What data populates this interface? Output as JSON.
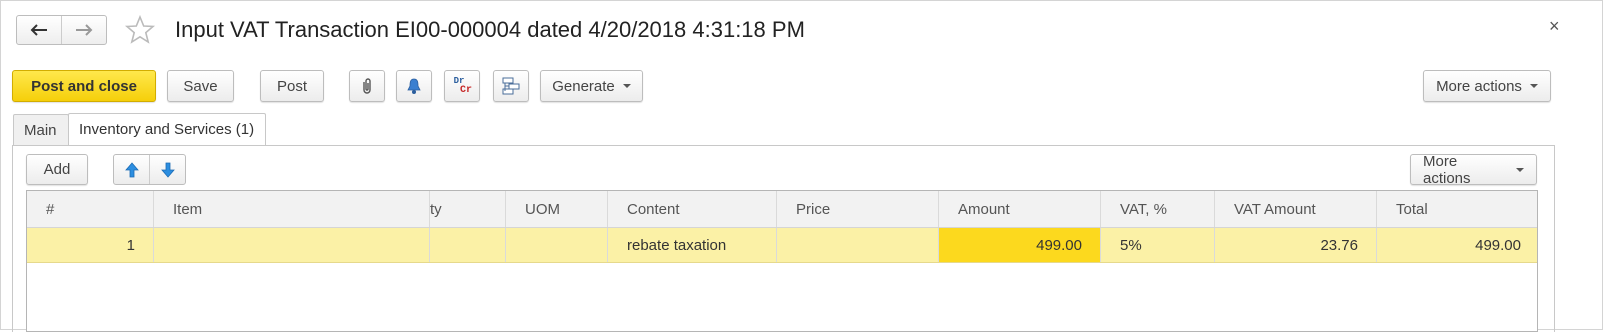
{
  "window": {
    "title": "Input VAT Transaction EI00-000004 dated 4/20/2018 4:31:18 PM",
    "close_label": "×"
  },
  "toolbar": {
    "post_close_label": "Post and close",
    "save_label": "Save",
    "post_label": "Post",
    "generate_label": "Generate",
    "more_actions_label": "More actions",
    "dr_label": "Dr",
    "cr_label": "Cr"
  },
  "tabs": [
    {
      "label": "Main",
      "active": false
    },
    {
      "label": "Inventory and Services (1)",
      "active": true
    }
  ],
  "subtoolbar": {
    "add_label": "Add",
    "more_actions_label": "More actions"
  },
  "table": {
    "columns": [
      "#",
      "Item",
      "ty",
      "UOM",
      "Content",
      "Price",
      "Amount",
      "VAT, %",
      "VAT Amount",
      "Total"
    ],
    "rows": [
      {
        "num": "1",
        "item": "",
        "qty": "",
        "uom": "",
        "content": "rebate taxation",
        "price": "",
        "amount": "499.00",
        "vat_pct": "5%",
        "vat_amount": "23.76",
        "total": "499.00"
      }
    ]
  },
  "colors": {
    "primary_button": "#f5cf0a",
    "selected_row": "#fbf1a6",
    "active_cell": "#fcd91e",
    "arrow_blue": "#2c8ee0"
  }
}
